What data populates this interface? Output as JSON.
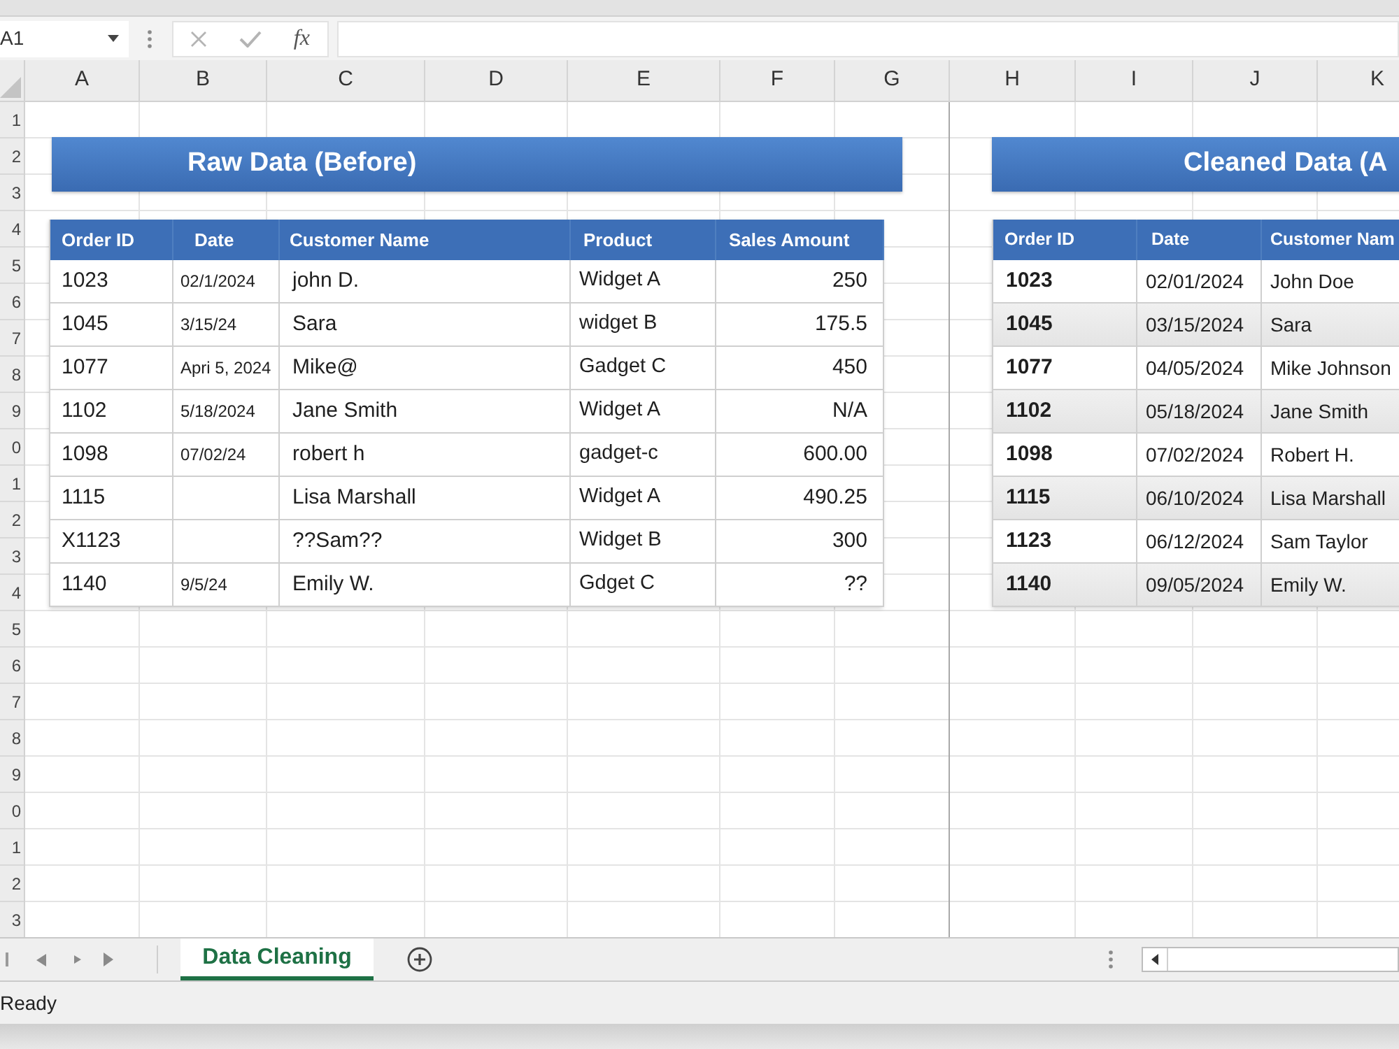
{
  "formula_bar": {
    "name_box": "A1",
    "function_button": "fx"
  },
  "column_headers": [
    "A",
    "B",
    "C",
    "D",
    "E",
    "F",
    "G",
    "H",
    "I",
    "J",
    "K"
  ],
  "row_headers": [
    "1",
    "2",
    "3",
    "4",
    "5",
    "6",
    "7",
    "8",
    "9",
    "0",
    "1",
    "2",
    "3",
    "4",
    "5",
    "6",
    "7",
    "8",
    "9",
    "0",
    "1",
    "2",
    "3"
  ],
  "raw_table": {
    "title": "Raw Data (Before)",
    "columns": [
      "Order ID",
      "Date",
      "Customer Name",
      "Product",
      "Sales Amount"
    ],
    "rows": [
      [
        "1023",
        "02/1/2024",
        "john D.",
        "Widget A",
        "250"
      ],
      [
        "1045",
        "3/15/24",
        "Sara",
        "widget B",
        "175.5"
      ],
      [
        "1077",
        "Apri 5, 2024",
        "Mike@",
        "Gadget C",
        "450"
      ],
      [
        "1102",
        "5/18/2024",
        "Jane Smith",
        "Widget A",
        "N/A"
      ],
      [
        "1098",
        "07/02/24",
        "robert h",
        "gadget-c",
        "600.00"
      ],
      [
        "1115",
        null,
        "Lisa Marshall",
        "Widget A",
        "490.25"
      ],
      [
        "X1123",
        null,
        "??Sam??",
        "Widget B",
        "300"
      ],
      [
        "1140",
        "9/5/24",
        "Emily W.",
        "Gdget C",
        "??"
      ]
    ]
  },
  "cleaned_table": {
    "title": "Cleaned Data (A",
    "columns": [
      "Order ID",
      "Date",
      "Customer Nam"
    ],
    "rows": [
      [
        "1023",
        "02/01/2024",
        "John Doe"
      ],
      [
        "1045",
        "03/15/2024",
        "Sara"
      ],
      [
        "1077",
        "04/05/2024",
        "Mike Johnson"
      ],
      [
        "1102",
        "05/18/2024",
        "Jane Smith"
      ],
      [
        "1098",
        "07/02/2024",
        "Robert H."
      ],
      [
        "1115",
        "06/10/2024",
        "Lisa Marshall"
      ],
      [
        "1123",
        "06/12/2024",
        "Sam Taylor"
      ],
      [
        "1140",
        "09/05/2024",
        "Emily W."
      ]
    ]
  },
  "sheet_tabs": [
    {
      "label": "Data Cleaning",
      "selected": true
    }
  ],
  "status_bar": {
    "text": "Ready"
  }
}
